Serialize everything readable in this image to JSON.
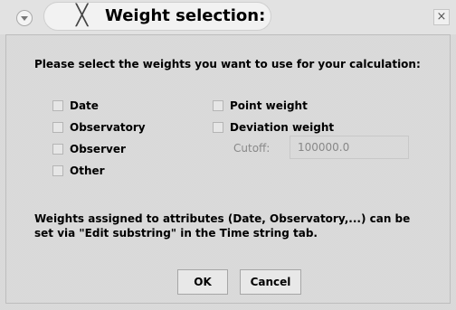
{
  "window": {
    "title": "Weight selection:",
    "title_icon": "x-logo-icon",
    "menu_icon": "chevron-down-icon",
    "close_glyph": "×"
  },
  "instruction": "Please select the weights you want to use for your calculation:",
  "weights_left": [
    {
      "label": "Date",
      "checked": false
    },
    {
      "label": "Observatory",
      "checked": false
    },
    {
      "label": "Observer",
      "checked": false
    },
    {
      "label": "Other",
      "checked": false
    }
  ],
  "weights_right": [
    {
      "label": "Point weight",
      "checked": false
    },
    {
      "label": "Deviation weight",
      "checked": false
    }
  ],
  "cutoff": {
    "label": "Cutoff:",
    "value": "100000.0",
    "enabled": false
  },
  "note": {
    "line1": "Weights assigned to attributes (Date, Observatory,...) can be",
    "line2": "set via \"Edit substring\" in the Time string tab."
  },
  "buttons": {
    "ok": "OK",
    "cancel": "Cancel"
  },
  "colors": {
    "background": "#d3d3d3",
    "disabled_text": "#888888"
  }
}
